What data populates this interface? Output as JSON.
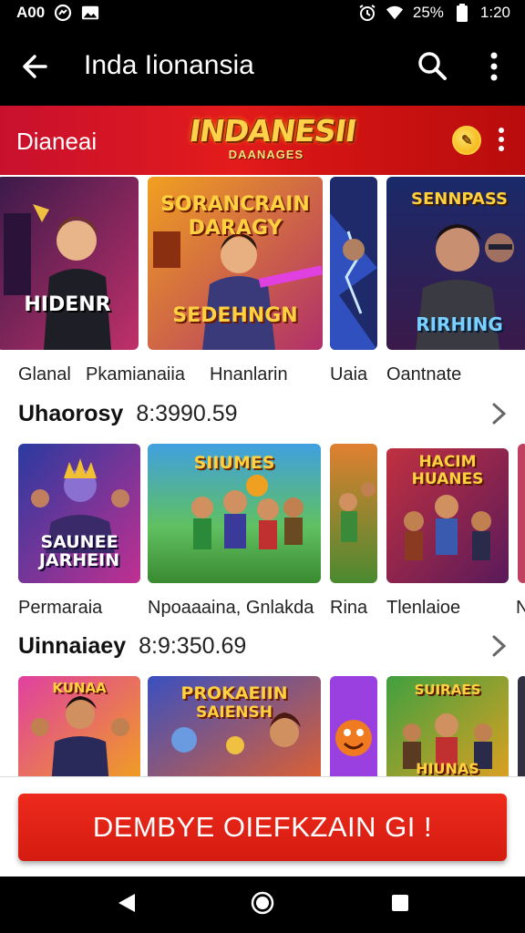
{
  "status_bar": {
    "left_text": "A00",
    "battery": "25%",
    "time": "1:20",
    "icons": [
      "messenger-icon",
      "gallery-icon",
      "alarm-icon",
      "wifi-icon",
      "battery-icon"
    ]
  },
  "app_bar": {
    "title": "Inda Iionansia",
    "icons": [
      "back-arrow-icon",
      "search-icon",
      "more-vert-icon"
    ]
  },
  "banner": {
    "label": "Dianeai",
    "logo_main": "INDANESII",
    "logo_sub": "DAANAGES"
  },
  "rows": [
    {
      "tiles": [
        {
          "art_text": "HIDENR",
          "caption": "Glanal"
        },
        {
          "art_text": "SORANCRAIN DARAGY",
          "art_text2": "SEDEHNGN",
          "caption": "Pkamianaiia"
        },
        {
          "caption": "Hnanlarin"
        },
        {
          "caption": "Uaia"
        },
        {
          "art_text": "SENNPASS",
          "art_text2": "RIRHING",
          "caption": "Oantnate"
        }
      ]
    },
    {
      "heading": "Uhaorosy",
      "value": "8:3990.59",
      "tiles": [
        {
          "art_text": "SAUNEE JARHEIN",
          "caption": "Permaraia"
        },
        {
          "art_text": "SIIUMES",
          "caption": "Npoaaaina, Gnlakda"
        },
        {
          "caption": "Rina"
        },
        {
          "art_text": "HACIM HUANES",
          "caption": "Tlenlaioe"
        },
        {
          "caption": "N"
        }
      ]
    },
    {
      "heading": "Uinnaiaey",
      "value": "8:9:350.69",
      "tiles": [
        {
          "art_text": "KUNAA"
        },
        {
          "art_text": "PROKAEIIN",
          "art_text2": "SAIENSH"
        },
        {},
        {
          "art_text": "SUIRAES",
          "art_text2": "HIUNAS"
        }
      ]
    }
  ],
  "cta": {
    "label": "DEMBYE OIEFKZAIN GI !"
  },
  "nav": {
    "icons": [
      "nav-back-icon",
      "nav-home-icon",
      "nav-recents-icon"
    ]
  },
  "colors": {
    "accent_red": "#e31b1b",
    "banner_red": "#c8102e",
    "cta_red": "#e02416",
    "gold": "#ffd24a"
  }
}
